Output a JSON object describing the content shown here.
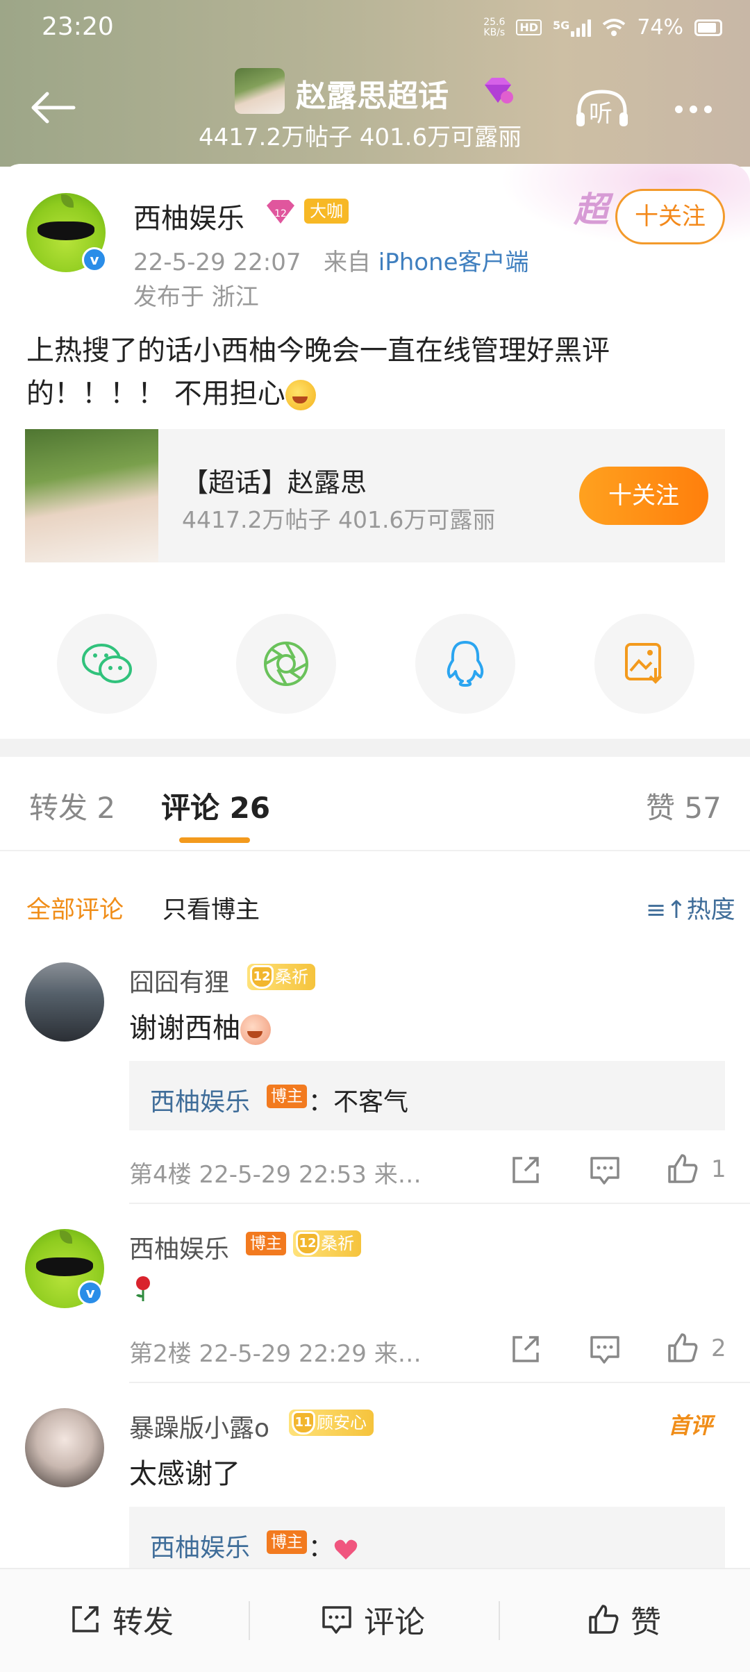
{
  "status_bar": {
    "time": "23:20",
    "net_speed_value": "25.6",
    "net_speed_unit": "KB/s",
    "hd": "HD",
    "network": "5G",
    "battery": "74%"
  },
  "header": {
    "title": "赵露思超话",
    "stats": "4417.2万帖子 401.6万可露丽",
    "listen_label": "听"
  },
  "post": {
    "deco_label": "超",
    "author": "西柚娱乐",
    "level": "12",
    "badge": "大咖",
    "follow_label": "十关注",
    "time": "22-5-29 22:07",
    "source_prefix": "来自",
    "source": "iPhone客户端",
    "location": "发布于 浙江",
    "text_line1": "上热搜了的话小西柚今晚会一直在线管理好黑评",
    "text_line2": "的！！！！ 不用担心"
  },
  "topic_card": {
    "title": "【超话】赵露思",
    "stats": "4417.2万帖子 401.6万可露丽",
    "follow_label": "十关注"
  },
  "share_targets": [
    "wechat-icon",
    "moments-icon",
    "qq-icon",
    "save-image-icon"
  ],
  "tabs": {
    "repost": "转发 2",
    "comment": "评论 26",
    "like": "赞 57"
  },
  "filters": {
    "all": "全部评论",
    "blogger_only": "只看博主",
    "sort": "热度"
  },
  "comments": [
    {
      "user": "囧囧有狸",
      "level": "12",
      "level_name": "桑祈",
      "text": "谢谢西柚",
      "reply": {
        "user": "西柚娱乐",
        "tag": "博主",
        "text": "：不客气"
      },
      "meta": "第4楼 22-5-29 22:53 来…",
      "likes": "1"
    },
    {
      "user": "西柚娱乐",
      "tag": "博主",
      "level": "12",
      "level_name": "桑祈",
      "text": "",
      "meta": "第2楼 22-5-29 22:29 来…",
      "likes": "2"
    },
    {
      "user": "暴躁版小露o",
      "level": "11",
      "level_name": "顾安心",
      "first_tag": "首评",
      "text": "太感谢了",
      "reply": {
        "user": "西柚娱乐",
        "tag": "博主",
        "text": "："
      }
    }
  ],
  "bottom_bar": {
    "repost": "转发",
    "comment": "评论",
    "like": "赞"
  },
  "colors": {
    "accent": "#f39a1d",
    "link": "#3f6d99",
    "follow_gradient": "#ff7f0c"
  }
}
